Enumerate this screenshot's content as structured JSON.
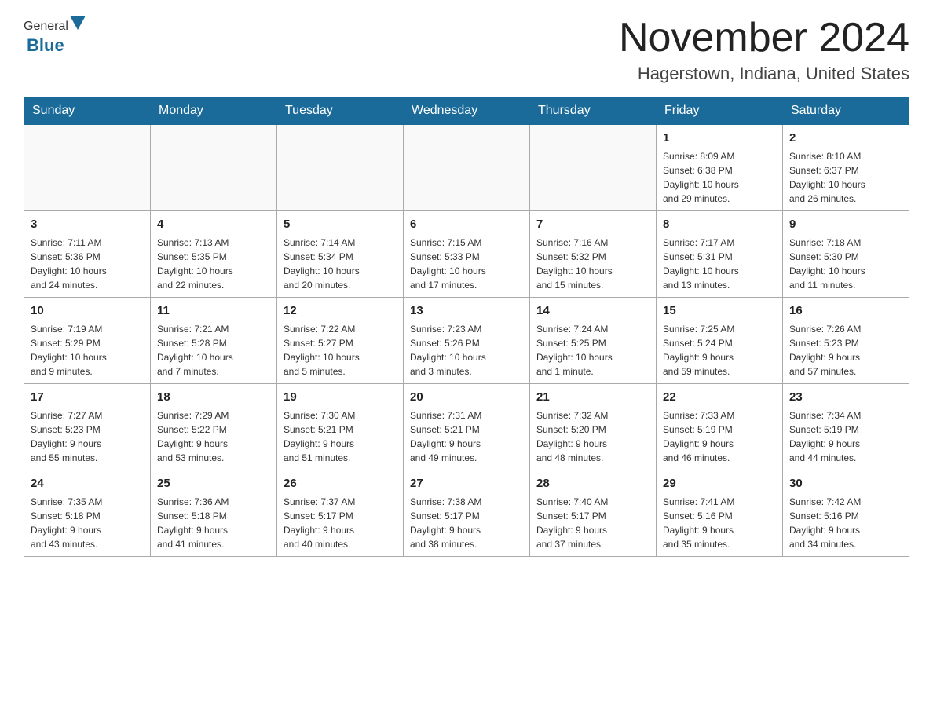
{
  "header": {
    "logo_general": "General",
    "logo_blue": "Blue",
    "month_title": "November 2024",
    "location": "Hagerstown, Indiana, United States"
  },
  "days_of_week": [
    "Sunday",
    "Monday",
    "Tuesday",
    "Wednesday",
    "Thursday",
    "Friday",
    "Saturday"
  ],
  "weeks": [
    [
      {
        "day": "",
        "info": ""
      },
      {
        "day": "",
        "info": ""
      },
      {
        "day": "",
        "info": ""
      },
      {
        "day": "",
        "info": ""
      },
      {
        "day": "",
        "info": ""
      },
      {
        "day": "1",
        "info": "Sunrise: 8:09 AM\nSunset: 6:38 PM\nDaylight: 10 hours\nand 29 minutes."
      },
      {
        "day": "2",
        "info": "Sunrise: 8:10 AM\nSunset: 6:37 PM\nDaylight: 10 hours\nand 26 minutes."
      }
    ],
    [
      {
        "day": "3",
        "info": "Sunrise: 7:11 AM\nSunset: 5:36 PM\nDaylight: 10 hours\nand 24 minutes."
      },
      {
        "day": "4",
        "info": "Sunrise: 7:13 AM\nSunset: 5:35 PM\nDaylight: 10 hours\nand 22 minutes."
      },
      {
        "day": "5",
        "info": "Sunrise: 7:14 AM\nSunset: 5:34 PM\nDaylight: 10 hours\nand 20 minutes."
      },
      {
        "day": "6",
        "info": "Sunrise: 7:15 AM\nSunset: 5:33 PM\nDaylight: 10 hours\nand 17 minutes."
      },
      {
        "day": "7",
        "info": "Sunrise: 7:16 AM\nSunset: 5:32 PM\nDaylight: 10 hours\nand 15 minutes."
      },
      {
        "day": "8",
        "info": "Sunrise: 7:17 AM\nSunset: 5:31 PM\nDaylight: 10 hours\nand 13 minutes."
      },
      {
        "day": "9",
        "info": "Sunrise: 7:18 AM\nSunset: 5:30 PM\nDaylight: 10 hours\nand 11 minutes."
      }
    ],
    [
      {
        "day": "10",
        "info": "Sunrise: 7:19 AM\nSunset: 5:29 PM\nDaylight: 10 hours\nand 9 minutes."
      },
      {
        "day": "11",
        "info": "Sunrise: 7:21 AM\nSunset: 5:28 PM\nDaylight: 10 hours\nand 7 minutes."
      },
      {
        "day": "12",
        "info": "Sunrise: 7:22 AM\nSunset: 5:27 PM\nDaylight: 10 hours\nand 5 minutes."
      },
      {
        "day": "13",
        "info": "Sunrise: 7:23 AM\nSunset: 5:26 PM\nDaylight: 10 hours\nand 3 minutes."
      },
      {
        "day": "14",
        "info": "Sunrise: 7:24 AM\nSunset: 5:25 PM\nDaylight: 10 hours\nand 1 minute."
      },
      {
        "day": "15",
        "info": "Sunrise: 7:25 AM\nSunset: 5:24 PM\nDaylight: 9 hours\nand 59 minutes."
      },
      {
        "day": "16",
        "info": "Sunrise: 7:26 AM\nSunset: 5:23 PM\nDaylight: 9 hours\nand 57 minutes."
      }
    ],
    [
      {
        "day": "17",
        "info": "Sunrise: 7:27 AM\nSunset: 5:23 PM\nDaylight: 9 hours\nand 55 minutes."
      },
      {
        "day": "18",
        "info": "Sunrise: 7:29 AM\nSunset: 5:22 PM\nDaylight: 9 hours\nand 53 minutes."
      },
      {
        "day": "19",
        "info": "Sunrise: 7:30 AM\nSunset: 5:21 PM\nDaylight: 9 hours\nand 51 minutes."
      },
      {
        "day": "20",
        "info": "Sunrise: 7:31 AM\nSunset: 5:21 PM\nDaylight: 9 hours\nand 49 minutes."
      },
      {
        "day": "21",
        "info": "Sunrise: 7:32 AM\nSunset: 5:20 PM\nDaylight: 9 hours\nand 48 minutes."
      },
      {
        "day": "22",
        "info": "Sunrise: 7:33 AM\nSunset: 5:19 PM\nDaylight: 9 hours\nand 46 minutes."
      },
      {
        "day": "23",
        "info": "Sunrise: 7:34 AM\nSunset: 5:19 PM\nDaylight: 9 hours\nand 44 minutes."
      }
    ],
    [
      {
        "day": "24",
        "info": "Sunrise: 7:35 AM\nSunset: 5:18 PM\nDaylight: 9 hours\nand 43 minutes."
      },
      {
        "day": "25",
        "info": "Sunrise: 7:36 AM\nSunset: 5:18 PM\nDaylight: 9 hours\nand 41 minutes."
      },
      {
        "day": "26",
        "info": "Sunrise: 7:37 AM\nSunset: 5:17 PM\nDaylight: 9 hours\nand 40 minutes."
      },
      {
        "day": "27",
        "info": "Sunrise: 7:38 AM\nSunset: 5:17 PM\nDaylight: 9 hours\nand 38 minutes."
      },
      {
        "day": "28",
        "info": "Sunrise: 7:40 AM\nSunset: 5:17 PM\nDaylight: 9 hours\nand 37 minutes."
      },
      {
        "day": "29",
        "info": "Sunrise: 7:41 AM\nSunset: 5:16 PM\nDaylight: 9 hours\nand 35 minutes."
      },
      {
        "day": "30",
        "info": "Sunrise: 7:42 AM\nSunset: 5:16 PM\nDaylight: 9 hours\nand 34 minutes."
      }
    ]
  ]
}
